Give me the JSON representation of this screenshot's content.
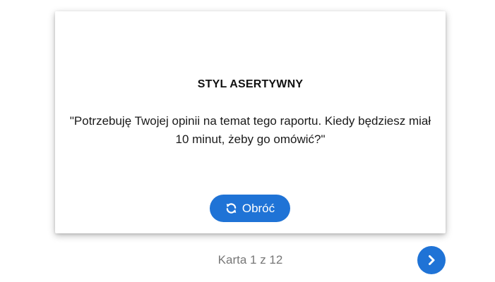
{
  "card": {
    "title": "STYL ASERTYWNY",
    "quote": "\"Potrzebuję Twojej opinii na temat tego raportu. Kiedy będziesz miał 10 minut, żeby go omówić?\"",
    "flip_button": {
      "label": "Obróć",
      "icon": "refresh-icon"
    }
  },
  "navigation": {
    "counter": "Karta 1 z 12",
    "next_icon": "chevron-right-icon"
  },
  "colors": {
    "accent": "#1f73d6",
    "counter_text": "#777777"
  }
}
